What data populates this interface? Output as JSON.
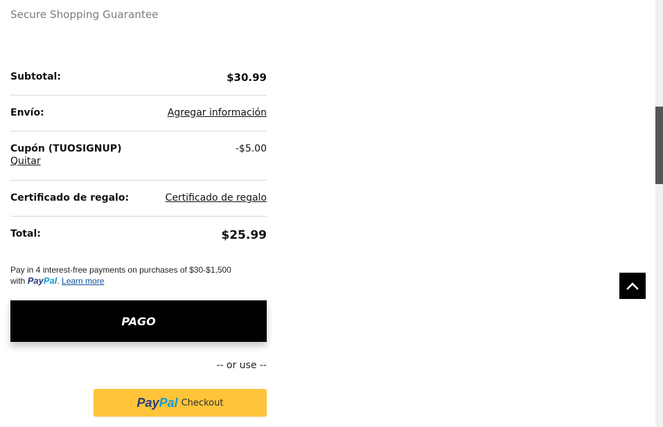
{
  "header": {
    "guarantee_text": "Secure Shopping Guarantee"
  },
  "summary": {
    "subtotal": {
      "label": "Subtotal:",
      "value": "$30.99"
    },
    "shipping": {
      "label": "Envío:",
      "link": "Agregar información"
    },
    "coupon": {
      "label": "Cupón (TUOSIGNUP)",
      "remove_link": "Quitar",
      "value": "-$5.00"
    },
    "gift": {
      "label": "Certificado de regalo:",
      "link": "Certificado de regalo"
    },
    "total": {
      "label": "Total:",
      "value": "$25.99"
    }
  },
  "paylater": {
    "line1": "Pay in 4 interest-free payments on purchases of $30-$1,500",
    "with": "with",
    "brand_pay": "Pay",
    "brand_pal": "Pal",
    "period": ".",
    "learn_more": "Learn more"
  },
  "checkout": {
    "pago_label": "PAGO",
    "or_use": "-- or use --",
    "paypal_pay": "Pay",
    "paypal_pal": "Pal",
    "paypal_checkout": "Checkout"
  },
  "icons": {
    "back_to_top": "chevron-up-icon"
  },
  "colors": {
    "paypal_button": "#ffc439",
    "paypal_dark_blue": "#253b80",
    "paypal_light_blue": "#179bd7",
    "primary_button": "#000000"
  }
}
